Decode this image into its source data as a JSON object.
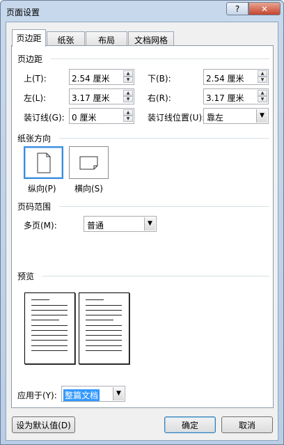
{
  "window": {
    "title": "页面设置",
    "help_label": "?",
    "close_label": "✕"
  },
  "tabs": [
    {
      "label": "页边距",
      "active": true
    },
    {
      "label": "纸张",
      "active": false
    },
    {
      "label": "布局",
      "active": false
    },
    {
      "label": "文档网格",
      "active": false
    }
  ],
  "margins": {
    "section_title": "页边距",
    "top": {
      "label": "上(T):",
      "value": "2.54 厘米"
    },
    "bottom": {
      "label": "下(B):",
      "value": "2.54 厘米"
    },
    "left": {
      "label": "左(L):",
      "value": "3.17 厘米"
    },
    "right": {
      "label": "右(R):",
      "value": "3.17 厘米"
    },
    "gutter": {
      "label": "装订线(G):",
      "value": "0 厘米"
    },
    "gutter_position": {
      "label": "装订线位置(U):",
      "value": "靠左"
    }
  },
  "orientation": {
    "section_title": "纸张方向",
    "portrait_label": "纵向(P)",
    "landscape_label": "横向(S)",
    "selected": "portrait"
  },
  "pages": {
    "section_title": "页码范围",
    "multiple_label": "多页(M):",
    "multiple_value": "普通"
  },
  "preview": {
    "section_title": "预览",
    "apply_label": "应用于(Y):",
    "apply_value": "整篇文档"
  },
  "buttons": {
    "set_default": "设为默认值(D)",
    "ok": "确定",
    "cancel": "取消"
  }
}
